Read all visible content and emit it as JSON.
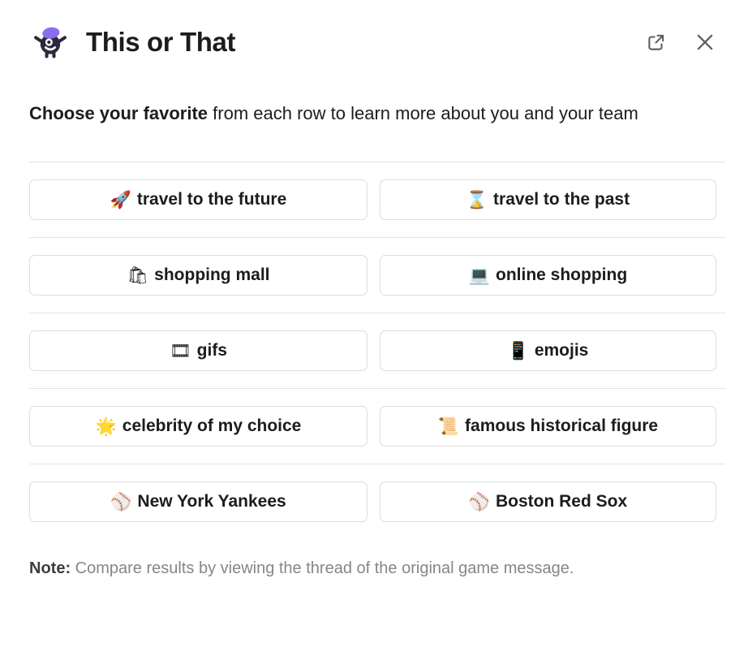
{
  "header": {
    "title": "This or That",
    "app_icon": "monster-avatar-icon",
    "icon_colors": {
      "body": "#2b2a3d",
      "hat": "#8b6bf0"
    },
    "actions": [
      {
        "name": "open-in-new-icon",
        "label": "Open in new window"
      },
      {
        "name": "close-icon",
        "label": "Close"
      }
    ]
  },
  "intro": {
    "bold": "Choose your favorite",
    "rest": " from each row to learn more about you and your team"
  },
  "rows": [
    {
      "left": {
        "emoji": "🚀",
        "emoji_name": "rocket-emoji",
        "label": "travel to the future"
      },
      "right": {
        "emoji": "⌛",
        "emoji_name": "hourglass-emoji",
        "label": "travel to the past"
      }
    },
    {
      "left": {
        "emoji": "🛍",
        "emoji_name": "shopping-bags-emoji",
        "label": "shopping mall"
      },
      "right": {
        "emoji": "💻",
        "emoji_name": "laptop-emoji",
        "label": "online shopping"
      }
    },
    {
      "left": {
        "emoji": "🎞",
        "emoji_name": "film-frames-emoji",
        "label": "gifs"
      },
      "right": {
        "emoji": "📱",
        "emoji_name": "mobile-phone-emoji",
        "label": "emojis"
      }
    },
    {
      "left": {
        "emoji": "🌟",
        "emoji_name": "glowing-star-emoji",
        "label": "celebrity of my choice"
      },
      "right": {
        "emoji": "📜",
        "emoji_name": "scroll-emoji",
        "label": "famous historical figure"
      }
    },
    {
      "left": {
        "emoji": "⚾",
        "emoji_name": "baseball-emoji",
        "label": "New York Yankees"
      },
      "right": {
        "emoji": "⚾",
        "emoji_name": "baseball-emoji",
        "label": "Boston Red Sox"
      }
    }
  ],
  "note": {
    "bold": "Note:",
    "rest": " Compare results by viewing the thread of the original game message."
  },
  "colors": {
    "text": "#1d1c1d",
    "muted": "#868686",
    "border": "#ddddde",
    "divider": "#e4e4e4",
    "accent": "#8b6bf0"
  }
}
